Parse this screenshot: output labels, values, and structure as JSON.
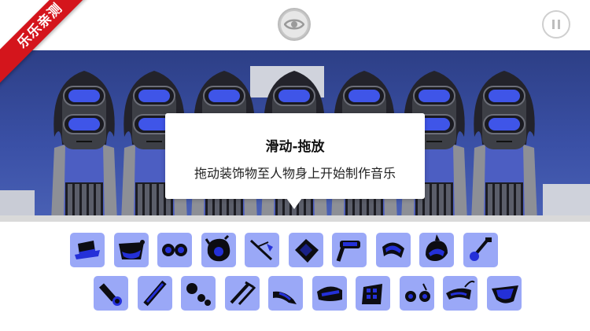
{
  "brand_ribbon": {
    "text": "乐乐亲测"
  },
  "toolbar": {
    "eye_icon": "eye-icon",
    "pause_icon": "pause-icon"
  },
  "tooltip": {
    "title": "滑动-拖放",
    "subtitle": "拖动装饰物至人物身上开始制作音乐"
  },
  "colors": {
    "accent_blue": "#3f55e8",
    "item_bg": "#9aa8f7",
    "ribbon_red": "#d4151c",
    "stage_blue": "#3a50a6"
  },
  "characters": {
    "count": 7
  },
  "palette": {
    "row1": [
      {
        "icon": "top-hat-icon"
      },
      {
        "icon": "bandana-icon"
      },
      {
        "icon": "goggles-icon"
      },
      {
        "icon": "messy-hair-icon"
      },
      {
        "icon": "antenna-icon"
      },
      {
        "icon": "square-mask-icon"
      },
      {
        "icon": "hammer-icon"
      },
      {
        "icon": "visor-icon"
      },
      {
        "icon": "spiky-helmet-icon"
      },
      {
        "icon": "guitar-icon"
      }
    ],
    "row2": [
      {
        "icon": "flashlight-icon"
      },
      {
        "icon": "stick-icon"
      },
      {
        "icon": "dots-icon"
      },
      {
        "icon": "bar-icon"
      },
      {
        "icon": "horn-icon"
      },
      {
        "icon": "cap-icon"
      },
      {
        "icon": "keypad-icon"
      },
      {
        "icon": "glasses-icon"
      },
      {
        "icon": "feather-hat-icon"
      },
      {
        "icon": "shell-icon"
      }
    ]
  }
}
